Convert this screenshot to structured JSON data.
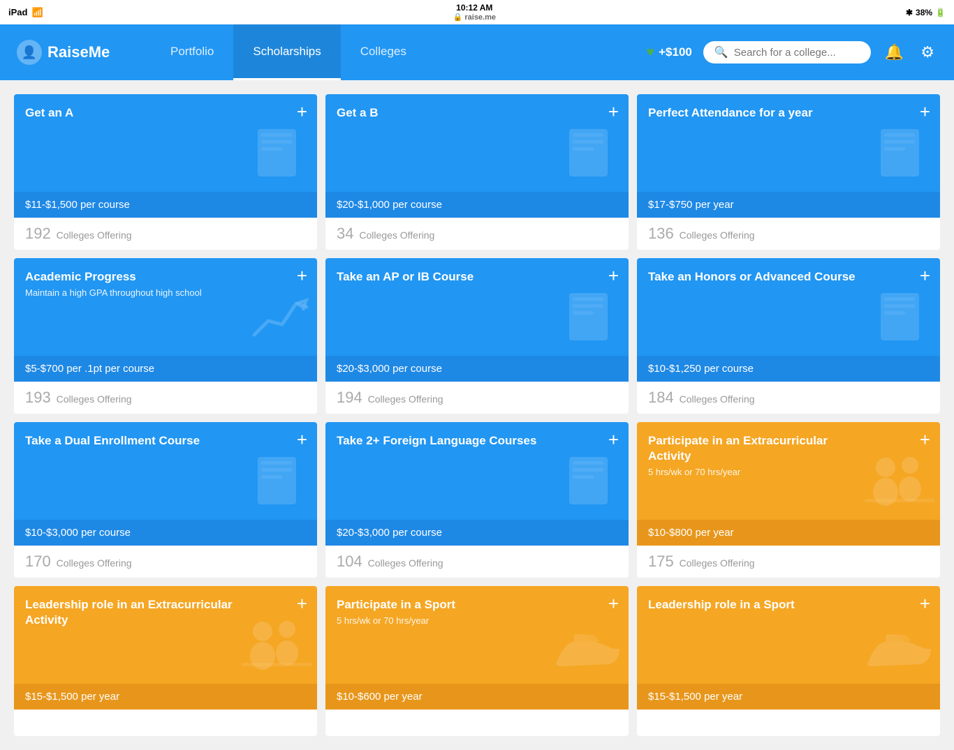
{
  "statusBar": {
    "device": "iPad",
    "wifi": "wifi",
    "time": "10:12 AM",
    "url": "raise.me",
    "bluetooth": "38%"
  },
  "navbar": {
    "brand": "RaiseMe",
    "links": [
      {
        "label": "Portfolio",
        "active": false
      },
      {
        "label": "Scholarships",
        "active": true
      },
      {
        "label": "Colleges",
        "active": false
      }
    ],
    "points": "+$100",
    "searchPlaceholder": "Search for a college..."
  },
  "cards": [
    {
      "id": "get-an-a",
      "title": "Get an A",
      "subtitle": "",
      "color": "blue",
      "price": "$11-$1,500 per course",
      "colleges": "192",
      "collegesLabel": "Colleges Offering",
      "icon": "book"
    },
    {
      "id": "get-a-b",
      "title": "Get a B",
      "subtitle": "",
      "color": "blue",
      "price": "$20-$1,000 per course",
      "colleges": "34",
      "collegesLabel": "Colleges Offering",
      "icon": "book"
    },
    {
      "id": "perfect-attendance",
      "title": "Perfect Attendance for a year",
      "subtitle": "",
      "color": "blue",
      "price": "$17-$750 per year",
      "colleges": "136",
      "collegesLabel": "Colleges Offering",
      "icon": "book"
    },
    {
      "id": "academic-progress",
      "title": "Academic Progress",
      "subtitle": "Maintain a high GPA throughout high school",
      "color": "blue",
      "price": "$5-$700 per .1pt per course",
      "colleges": "193",
      "collegesLabel": "Colleges Offering",
      "icon": "chart"
    },
    {
      "id": "ap-or-ib",
      "title": "Take an AP or IB Course",
      "subtitle": "",
      "color": "blue",
      "price": "$20-$3,000 per course",
      "colleges": "194",
      "collegesLabel": "Colleges Offering",
      "icon": "book"
    },
    {
      "id": "honors-advanced",
      "title": "Take an Honors or Advanced Course",
      "subtitle": "",
      "color": "blue",
      "price": "$10-$1,250 per course",
      "colleges": "184",
      "collegesLabel": "Colleges Offering",
      "icon": "book"
    },
    {
      "id": "dual-enrollment",
      "title": "Take a Dual Enrollment Course",
      "subtitle": "",
      "color": "blue",
      "price": "$10-$3,000 per course",
      "colleges": "170",
      "collegesLabel": "Colleges Offering",
      "icon": "book"
    },
    {
      "id": "foreign-language",
      "title": "Take 2+ Foreign Language Courses",
      "subtitle": "",
      "color": "blue",
      "price": "$20-$3,000 per course",
      "colleges": "104",
      "collegesLabel": "Colleges Offering",
      "icon": "book"
    },
    {
      "id": "extracurricular",
      "title": "Participate in an Extracurricular Activity",
      "subtitle": "5 hrs/wk or 70 hrs/year",
      "color": "orange",
      "price": "$10-$800 per year",
      "colleges": "175",
      "collegesLabel": "Colleges Offering",
      "icon": "people"
    },
    {
      "id": "leadership-extracurricular",
      "title": "Leadership role in an Extracurricular Activity",
      "subtitle": "",
      "color": "orange",
      "price": "$15-$1,500 per year",
      "colleges": "",
      "collegesLabel": "",
      "icon": "people"
    },
    {
      "id": "participate-sport",
      "title": "Participate in a Sport",
      "subtitle": "5 hrs/wk or 70 hrs/year",
      "color": "orange",
      "price": "$10-$600 per year",
      "colleges": "",
      "collegesLabel": "",
      "icon": "shoe"
    },
    {
      "id": "leadership-sport",
      "title": "Leadership role in a Sport",
      "subtitle": "",
      "color": "orange",
      "price": "$15-$1,500 per year",
      "colleges": "",
      "collegesLabel": "",
      "icon": "shoe"
    }
  ]
}
